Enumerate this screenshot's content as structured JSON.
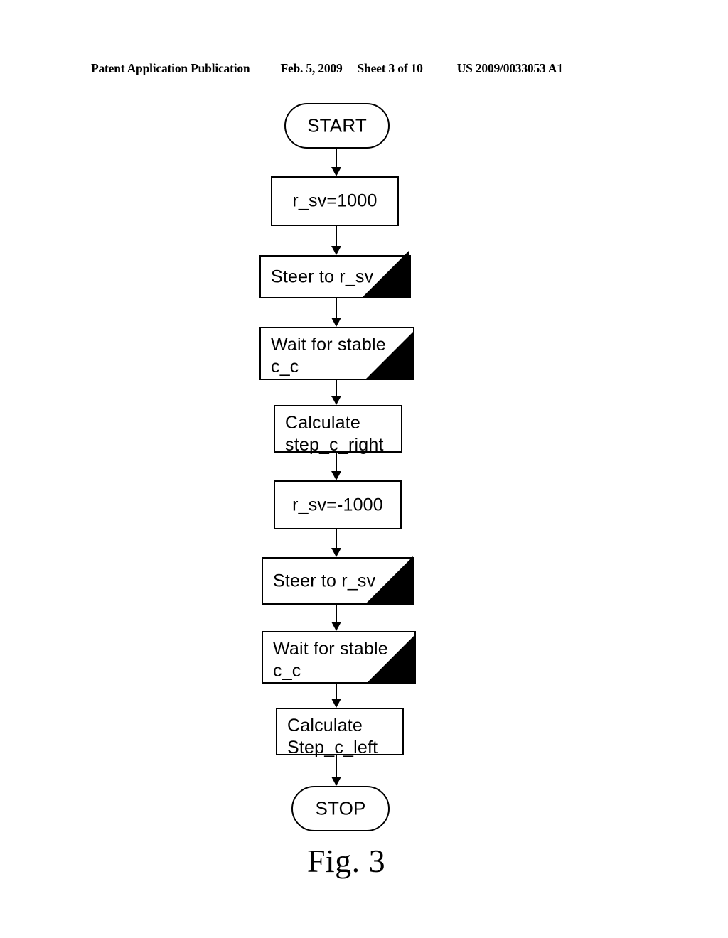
{
  "header": {
    "publication": "Patent Application Publication",
    "date": "Feb. 5, 2009",
    "sheet": "Sheet 3 of 10",
    "patent_number": "US 2009/0033053 A1"
  },
  "figure": {
    "caption": "Fig. 3"
  },
  "colors": {
    "ink": "#000000",
    "paper": "#ffffff"
  },
  "flowchart": {
    "title": "Fig. 3",
    "orientation": "top-to-bottom",
    "nodes": [
      {
        "id": "start",
        "type": "terminator",
        "label": "START",
        "marker": "none"
      },
      {
        "id": "rsv_pos",
        "type": "process",
        "label": "r_sv=1000",
        "marker": "none"
      },
      {
        "id": "steer_1",
        "type": "predefined-process",
        "label": "Steer to r_sv",
        "marker": "black-corner-triangle"
      },
      {
        "id": "wait_stable_1",
        "type": "predefined-process",
        "label": "Wait for stable\nc_c",
        "marker": "black-corner-triangle"
      },
      {
        "id": "calc_right",
        "type": "process",
        "label": "Calculate\nstep_c_right",
        "marker": "none"
      },
      {
        "id": "rsv_neg",
        "type": "process",
        "label": "r_sv=-1000",
        "marker": "none"
      },
      {
        "id": "steer_2",
        "type": "predefined-process",
        "label": "Steer to r_sv",
        "marker": "black-corner-triangle"
      },
      {
        "id": "wait_stable_2",
        "type": "predefined-process",
        "label": "Wait for stable\nc_c",
        "marker": "black-corner-triangle"
      },
      {
        "id": "calc_left",
        "type": "process",
        "label": "Calculate\nStep_c_left",
        "marker": "none"
      },
      {
        "id": "stop",
        "type": "terminator",
        "label": "STOP",
        "marker": "none"
      }
    ],
    "edges": [
      {
        "from": "start",
        "to": "rsv_pos",
        "arrow": "down"
      },
      {
        "from": "rsv_pos",
        "to": "steer_1",
        "arrow": "down"
      },
      {
        "from": "steer_1",
        "to": "wait_stable_1",
        "arrow": "down"
      },
      {
        "from": "wait_stable_1",
        "to": "calc_right",
        "arrow": "down"
      },
      {
        "from": "calc_right",
        "to": "rsv_neg",
        "arrow": "down"
      },
      {
        "from": "rsv_neg",
        "to": "steer_2",
        "arrow": "down"
      },
      {
        "from": "steer_2",
        "to": "wait_stable_2",
        "arrow": "down"
      },
      {
        "from": "wait_stable_2",
        "to": "calc_left",
        "arrow": "down"
      },
      {
        "from": "calc_left",
        "to": "stop",
        "arrow": "down"
      }
    ]
  }
}
